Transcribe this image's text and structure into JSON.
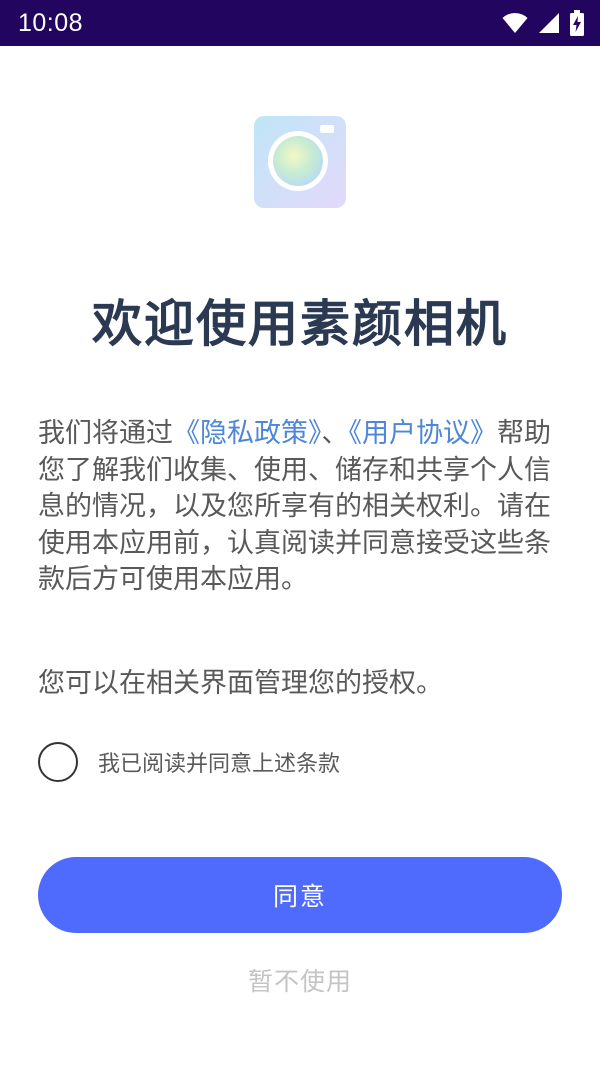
{
  "status_bar": {
    "time": "10:08",
    "icons": [
      "wifi-icon",
      "signal-icon",
      "battery-charging-icon"
    ],
    "background": "#22055e"
  },
  "app": {
    "icon": "camera-app-icon",
    "title": "欢迎使用素颜相机"
  },
  "agreement": {
    "intro": "我们将通过",
    "privacy_link": "《隐私政策》",
    "separator": "、",
    "terms_link": "《用户协议》",
    "body": "帮助您了解我们收集、使用、储存和共享个人信息的情况，以及您所享有的相关权利。请在使用本应用前，认真阅读并同意接受这些条款后方可使用本应用。",
    "auth_note": "您可以在相关界面管理您的授权。"
  },
  "consent": {
    "checked": false,
    "label": "我已阅读并同意上述条款"
  },
  "actions": {
    "agree_label": "同意",
    "decline_label": "暂不使用"
  },
  "colors": {
    "accent": "#4f6bfd",
    "link": "#4e86d8",
    "title": "#2b3a52",
    "body_text": "#595959",
    "muted": "#c4c4c4"
  }
}
